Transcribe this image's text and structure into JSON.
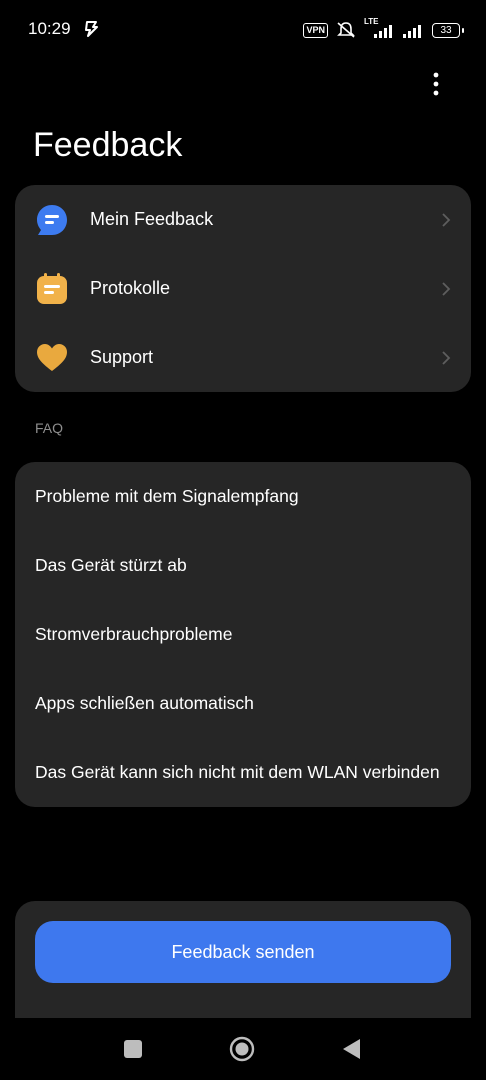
{
  "status_bar": {
    "time": "10:29",
    "vpn": "VPN",
    "network": "LTE",
    "battery": "33"
  },
  "page": {
    "title": "Feedback"
  },
  "menu": {
    "items": [
      {
        "label": "Mein Feedback",
        "icon": "chat-bubble-icon",
        "color": "#3d7bf0"
      },
      {
        "label": "Protokolle",
        "icon": "calendar-log-icon",
        "color": "#f1b24a"
      },
      {
        "label": "Support",
        "icon": "heart-icon",
        "color": "#e9a93e"
      }
    ]
  },
  "faq": {
    "section_label": "FAQ",
    "items": [
      "Probleme mit dem Signalempfang",
      "Das Gerät stürzt ab",
      "Stromverbrauchprobleme",
      "Apps schließen automatisch",
      "Das Gerät kann sich nicht mit dem WLAN verbinden"
    ]
  },
  "actions": {
    "send_label": "Feedback senden"
  },
  "colors": {
    "background": "#000000",
    "card": "#262626",
    "accent": "#3e78ee",
    "muted_text": "#8e8e8e"
  }
}
